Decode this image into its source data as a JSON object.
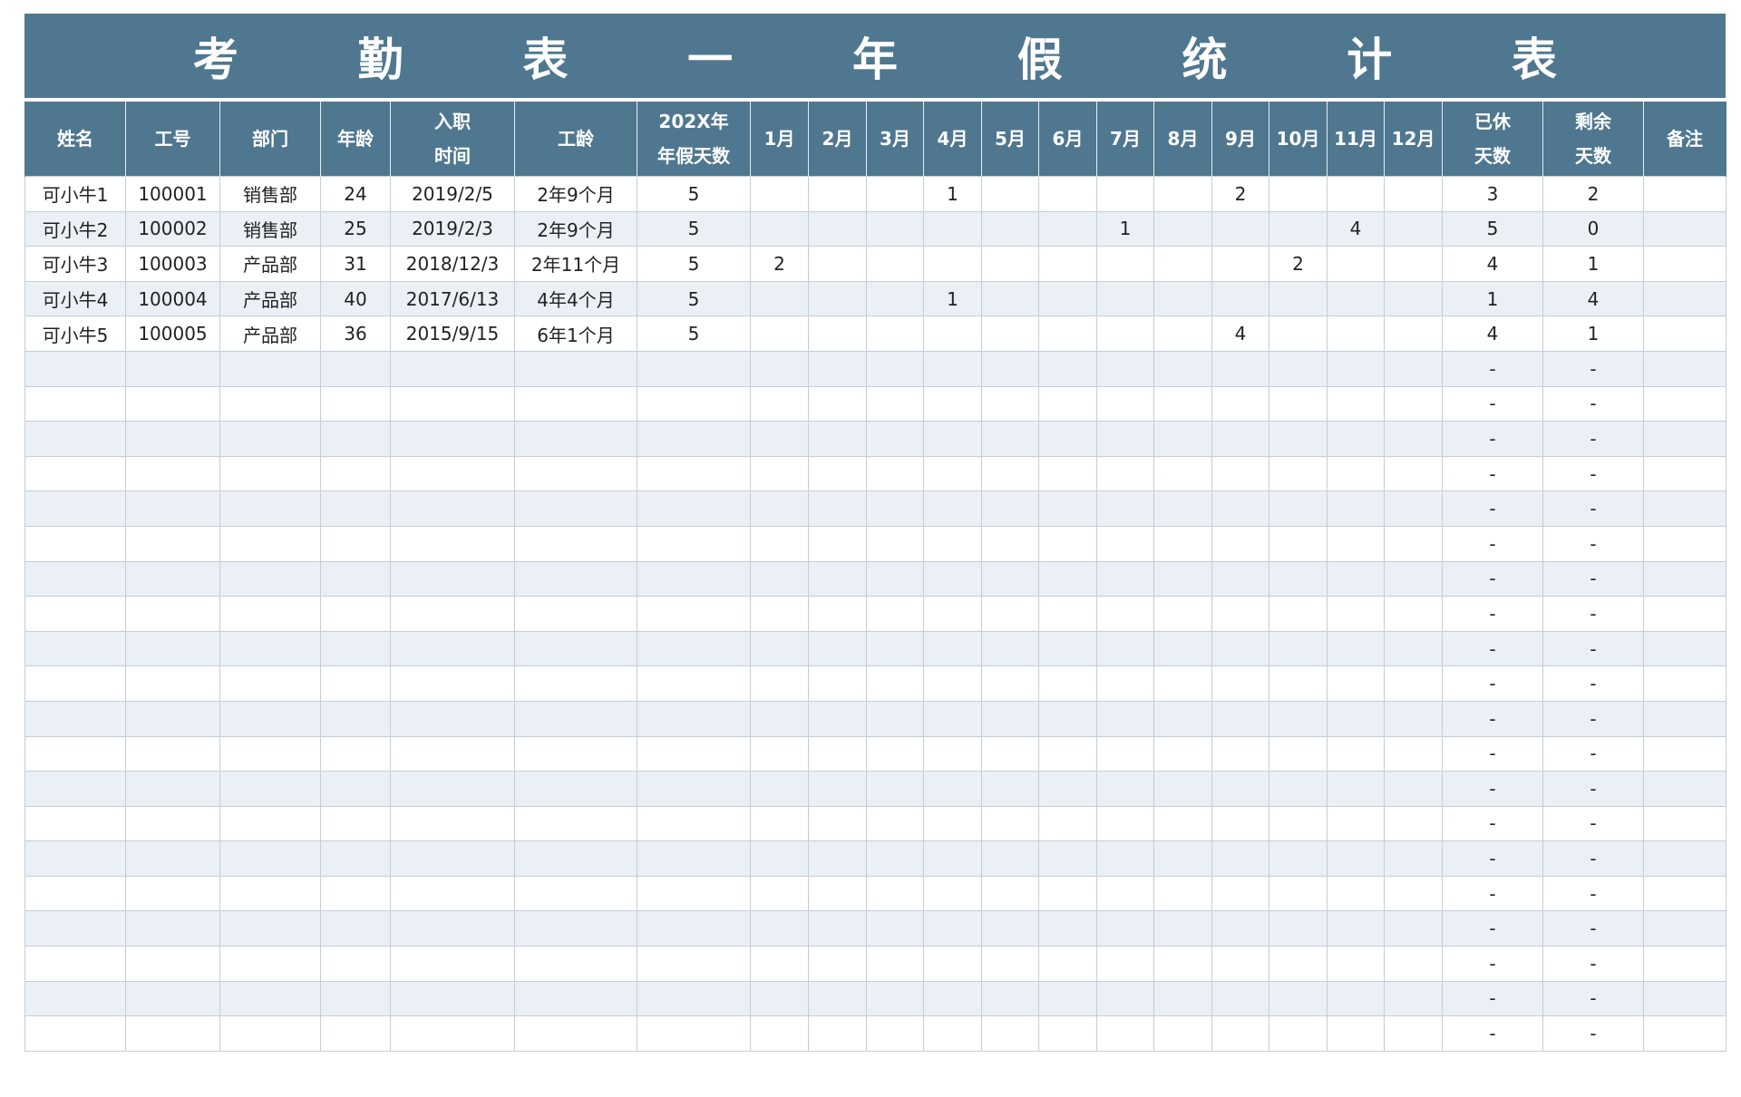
{
  "title_chars": [
    "考",
    "勤",
    "表",
    "一",
    "年",
    "假",
    "统",
    "计",
    "表"
  ],
  "colors": {
    "header_bg": "#4f7790",
    "header_text": "#ffffff",
    "stripe_row": "#eaf0f5",
    "grid_line": "#c5ced6"
  },
  "columns": [
    "姓名",
    "工号",
    "部门",
    "年龄",
    "入职\n时间",
    "工龄",
    "202X年\n年假天数",
    "1月",
    "2月",
    "3月",
    "4月",
    "5月",
    "6月",
    "7月",
    "8月",
    "9月",
    "10月",
    "11月",
    "12月",
    "已休\n天数",
    "剩余\n天数",
    "备注"
  ],
  "rows": [
    [
      "可小牛1",
      "100001",
      "销售部",
      "24",
      "2019/2/5",
      "2年9个月",
      "5",
      "",
      "",
      "",
      "1",
      "",
      "",
      "",
      "",
      "2",
      "",
      "",
      "",
      "3",
      "2",
      ""
    ],
    [
      "可小牛2",
      "100002",
      "销售部",
      "25",
      "2019/2/3",
      "2年9个月",
      "5",
      "",
      "",
      "",
      "",
      "",
      "",
      "1",
      "",
      "",
      "",
      "4",
      "",
      "5",
      "0",
      ""
    ],
    [
      "可小牛3",
      "100003",
      "产品部",
      "31",
      "2018/12/3",
      "2年11个月",
      "5",
      "2",
      "",
      "",
      "",
      "",
      "",
      "",
      "",
      "",
      "2",
      "",
      "",
      "4",
      "1",
      ""
    ],
    [
      "可小牛4",
      "100004",
      "产品部",
      "40",
      "2017/6/13",
      "4年4个月",
      "5",
      "",
      "",
      "",
      "1",
      "",
      "",
      "",
      "",
      "",
      "",
      "",
      "",
      "1",
      "4",
      ""
    ],
    [
      "可小牛5",
      "100005",
      "产品部",
      "36",
      "2015/9/15",
      "6年1个月",
      "5",
      "",
      "",
      "",
      "",
      "",
      "",
      "",
      "",
      "4",
      "",
      "",
      "",
      "4",
      "1",
      ""
    ],
    [
      "",
      "",
      "",
      "",
      "",
      "",
      "",
      "",
      "",
      "",
      "",
      "",
      "",
      "",
      "",
      "",
      "",
      "",
      "",
      "-",
      "-",
      ""
    ],
    [
      "",
      "",
      "",
      "",
      "",
      "",
      "",
      "",
      "",
      "",
      "",
      "",
      "",
      "",
      "",
      "",
      "",
      "",
      "",
      "-",
      "-",
      ""
    ],
    [
      "",
      "",
      "",
      "",
      "",
      "",
      "",
      "",
      "",
      "",
      "",
      "",
      "",
      "",
      "",
      "",
      "",
      "",
      "",
      "-",
      "-",
      ""
    ],
    [
      "",
      "",
      "",
      "",
      "",
      "",
      "",
      "",
      "",
      "",
      "",
      "",
      "",
      "",
      "",
      "",
      "",
      "",
      "",
      "-",
      "-",
      ""
    ],
    [
      "",
      "",
      "",
      "",
      "",
      "",
      "",
      "",
      "",
      "",
      "",
      "",
      "",
      "",
      "",
      "",
      "",
      "",
      "",
      "-",
      "-",
      ""
    ],
    [
      "",
      "",
      "",
      "",
      "",
      "",
      "",
      "",
      "",
      "",
      "",
      "",
      "",
      "",
      "",
      "",
      "",
      "",
      "",
      "-",
      "-",
      ""
    ],
    [
      "",
      "",
      "",
      "",
      "",
      "",
      "",
      "",
      "",
      "",
      "",
      "",
      "",
      "",
      "",
      "",
      "",
      "",
      "",
      "-",
      "-",
      ""
    ],
    [
      "",
      "",
      "",
      "",
      "",
      "",
      "",
      "",
      "",
      "",
      "",
      "",
      "",
      "",
      "",
      "",
      "",
      "",
      "",
      "-",
      "-",
      ""
    ],
    [
      "",
      "",
      "",
      "",
      "",
      "",
      "",
      "",
      "",
      "",
      "",
      "",
      "",
      "",
      "",
      "",
      "",
      "",
      "",
      "-",
      "-",
      ""
    ],
    [
      "",
      "",
      "",
      "",
      "",
      "",
      "",
      "",
      "",
      "",
      "",
      "",
      "",
      "",
      "",
      "",
      "",
      "",
      "",
      "-",
      "-",
      ""
    ],
    [
      "",
      "",
      "",
      "",
      "",
      "",
      "",
      "",
      "",
      "",
      "",
      "",
      "",
      "",
      "",
      "",
      "",
      "",
      "",
      "-",
      "-",
      ""
    ],
    [
      "",
      "",
      "",
      "",
      "",
      "",
      "",
      "",
      "",
      "",
      "",
      "",
      "",
      "",
      "",
      "",
      "",
      "",
      "",
      "-",
      "-",
      ""
    ],
    [
      "",
      "",
      "",
      "",
      "",
      "",
      "",
      "",
      "",
      "",
      "",
      "",
      "",
      "",
      "",
      "",
      "",
      "",
      "",
      "-",
      "-",
      ""
    ],
    [
      "",
      "",
      "",
      "",
      "",
      "",
      "",
      "",
      "",
      "",
      "",
      "",
      "",
      "",
      "",
      "",
      "",
      "",
      "",
      "-",
      "-",
      ""
    ],
    [
      "",
      "",
      "",
      "",
      "",
      "",
      "",
      "",
      "",
      "",
      "",
      "",
      "",
      "",
      "",
      "",
      "",
      "",
      "",
      "-",
      "-",
      ""
    ],
    [
      "",
      "",
      "",
      "",
      "",
      "",
      "",
      "",
      "",
      "",
      "",
      "",
      "",
      "",
      "",
      "",
      "",
      "",
      "",
      "-",
      "-",
      ""
    ],
    [
      "",
      "",
      "",
      "",
      "",
      "",
      "",
      "",
      "",
      "",
      "",
      "",
      "",
      "",
      "",
      "",
      "",
      "",
      "",
      "-",
      "-",
      ""
    ],
    [
      "",
      "",
      "",
      "",
      "",
      "",
      "",
      "",
      "",
      "",
      "",
      "",
      "",
      "",
      "",
      "",
      "",
      "",
      "",
      "-",
      "-",
      ""
    ],
    [
      "",
      "",
      "",
      "",
      "",
      "",
      "",
      "",
      "",
      "",
      "",
      "",
      "",
      "",
      "",
      "",
      "",
      "",
      "",
      "-",
      "-",
      ""
    ],
    [
      "",
      "",
      "",
      "",
      "",
      "",
      "",
      "",
      "",
      "",
      "",
      "",
      "",
      "",
      "",
      "",
      "",
      "",
      "",
      "-",
      "-",
      ""
    ]
  ]
}
